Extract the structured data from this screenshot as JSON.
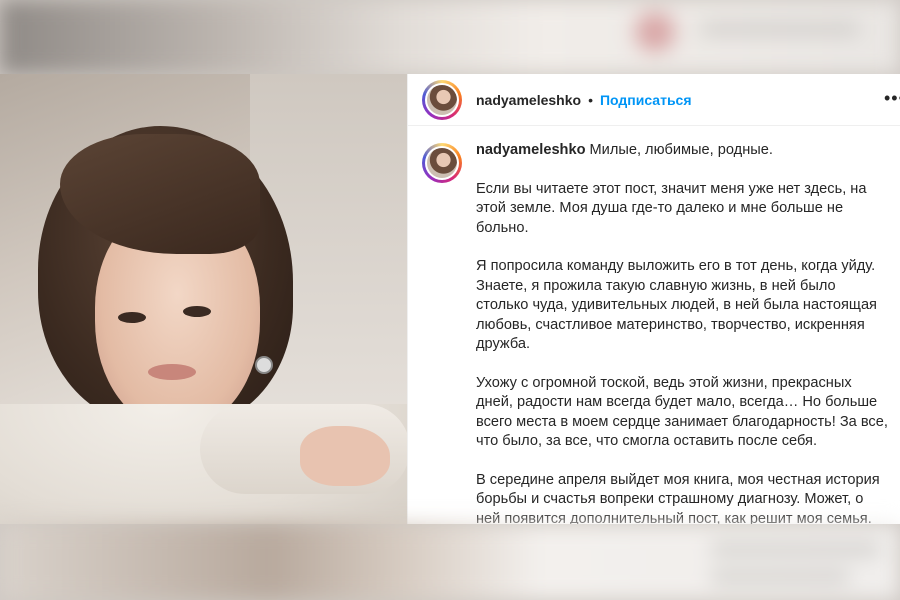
{
  "post": {
    "username": "nadyameleshko",
    "separator": "•",
    "follow_label": "Подписаться",
    "more_icon": "ellipsis-icon",
    "caption": {
      "username": "nadyameleshko",
      "first_line": "Милые, любимые, родные.",
      "paragraphs": [
        "Если вы читаете этот пост, значит меня уже нет здесь, на этой земле. Моя душа где-то далеко и мне больше не больно.",
        "Я попросила команду выложить его в тот день, когда уйду. Знаете, я прожила такую славную жизнь, в ней было столько чуда, удивительных людей, в ней была настоящая любовь, счастливое материнство, творчество, искренняя дружба.",
        "Ухожу с огромной тоской, ведь этой жизни, прекрасных дней, радости нам всегда будет мало, всегда… Но больше всего места в моем сердце занимает благодарность! За все, что было, за все, что смогла оставить после себя.",
        "В середине апреля выйдет моя книга, моя честная история борьбы и счастья вопреки страшному диагнозу. Может, о ней появится дополнительный пост, как решит моя семья."
      ]
    }
  }
}
